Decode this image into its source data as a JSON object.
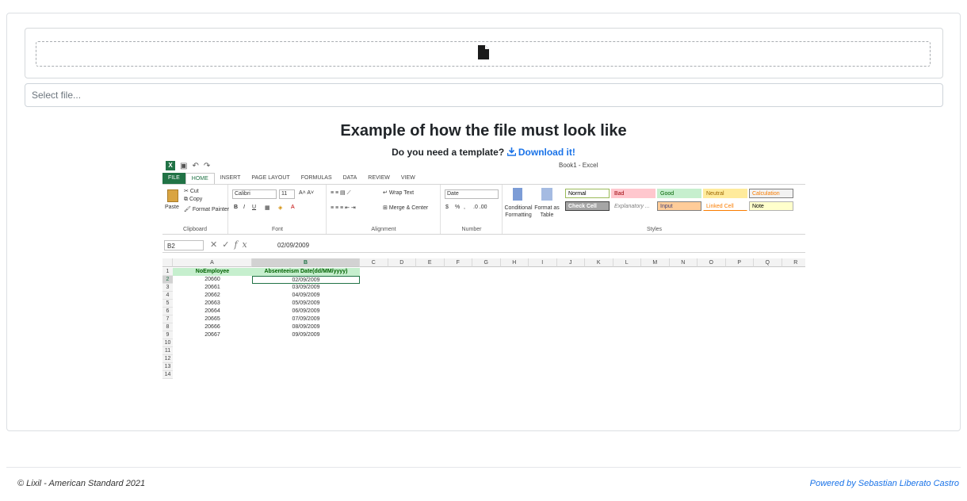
{
  "upload": {
    "close_label": "×",
    "file_icon": "file-icon",
    "placeholder": "Select file..."
  },
  "example": {
    "title": "Example of how the file must look like",
    "template_question": "Do you need a template?",
    "download_icon": "download-icon",
    "download_label": "Download it!",
    "link_color": "#1a73e8"
  },
  "excel": {
    "window_title": "Book1 - Excel",
    "tabs": [
      "FILE",
      "HOME",
      "INSERT",
      "PAGE LAYOUT",
      "FORMULAS",
      "DATA",
      "REVIEW",
      "VIEW"
    ],
    "ribbon": {
      "clipboard": {
        "paste": "Paste",
        "cut": "Cut",
        "copy": "Copy",
        "format_painter": "Format Painter",
        "label": "Clipboard"
      },
      "font": {
        "name": "Calibri",
        "size": "11",
        "label": "Font",
        "bold": "B",
        "italic": "I",
        "underline": "U"
      },
      "alignment": {
        "wrap": "Wrap Text",
        "merge": "Merge & Center",
        "label": "Alignment"
      },
      "number": {
        "format": "Date",
        "currency": "$",
        "percent": "%",
        "comma": ",",
        "label": "Number"
      },
      "styles": {
        "conditional": "Conditional Formatting",
        "format_table": "Format as Table",
        "label": "Styles",
        "cells": [
          {
            "name": "Normal",
            "bg": "#ffffff",
            "fg": "#000000",
            "border": "#9bbb59"
          },
          {
            "name": "Bad",
            "bg": "#ffc7ce",
            "fg": "#9c0006",
            "border": "#ffc7ce"
          },
          {
            "name": "Good",
            "bg": "#c6efce",
            "fg": "#006100",
            "border": "#c6efce"
          },
          {
            "name": "Neutral",
            "bg": "#ffeb9c",
            "fg": "#9c6500",
            "border": "#ffeb9c"
          },
          {
            "name": "Calculation",
            "bg": "#f2f2f2",
            "fg": "#fa7d00",
            "border": "#7f7f7f"
          },
          {
            "name": "Check Cell",
            "bg": "#a5a5a5",
            "fg": "#ffffff",
            "border": "#3f3f3f"
          },
          {
            "name": "Explanatory ...",
            "bg": "#ffffff",
            "fg": "#7f7f7f",
            "border": "#ffffff"
          },
          {
            "name": "Input",
            "bg": "#ffcc99",
            "fg": "#3f3f76",
            "border": "#7f7f7f"
          },
          {
            "name": "Linked Cell",
            "bg": "#ffffff",
            "fg": "#fa7d00",
            "border": "#ffffff"
          },
          {
            "name": "Note",
            "bg": "#ffffcc",
            "fg": "#000000",
            "border": "#b2b2b2"
          }
        ]
      }
    },
    "name_box": "B2",
    "formula_value": "02/09/2009",
    "columns": [
      "A",
      "B",
      "C",
      "D",
      "E",
      "F",
      "G",
      "H",
      "I",
      "J",
      "K",
      "L",
      "M",
      "N",
      "O",
      "P",
      "Q",
      "R"
    ],
    "selected_column": "B",
    "header_row": [
      "NoEmployee",
      "Absenteeism Date(dd/MM/yyyy)"
    ],
    "rows": [
      [
        "20660",
        "02/09/2009"
      ],
      [
        "20661",
        "03/09/2009"
      ],
      [
        "20662",
        "04/09/2009"
      ],
      [
        "20663",
        "05/09/2009"
      ],
      [
        "20664",
        "06/09/2009"
      ],
      [
        "20665",
        "07/09/2009"
      ],
      [
        "20666",
        "08/09/2009"
      ],
      [
        "20667",
        "09/09/2009"
      ]
    ],
    "row_numbers": [
      "1",
      "2",
      "3",
      "4",
      "5",
      "6",
      "7",
      "8",
      "9",
      "10",
      "11",
      "12",
      "13",
      "14"
    ]
  },
  "footer": {
    "copyright": "© Lixil - American Standard 2021",
    "powered_by": "Powered by Sebastian Liberato Castro"
  }
}
